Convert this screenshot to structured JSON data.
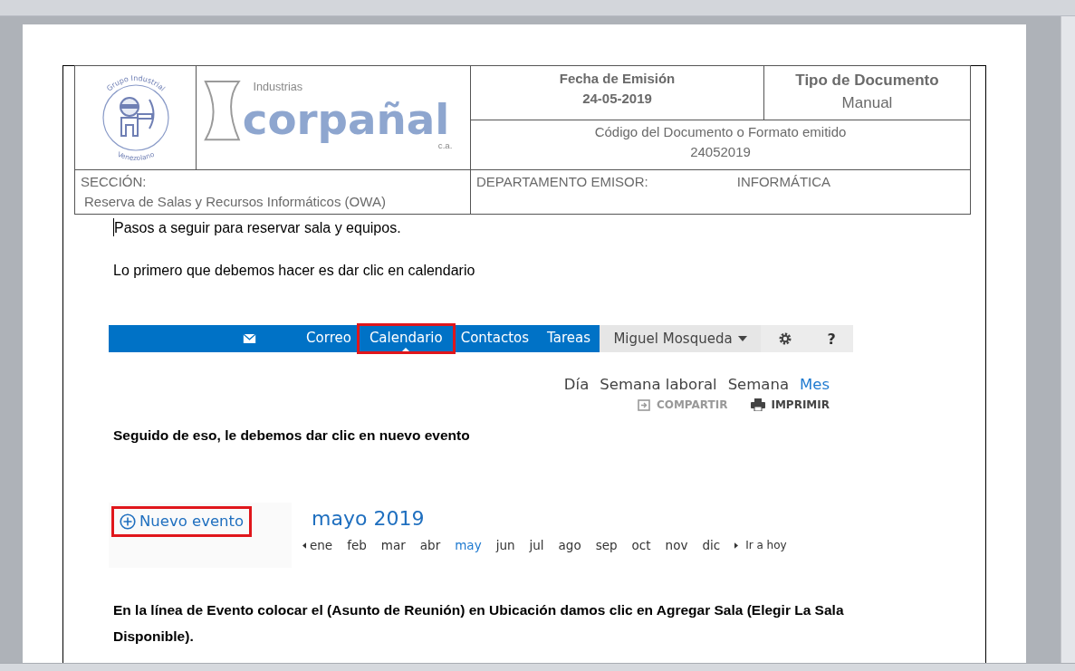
{
  "header_table": {
    "logo_left": {
      "top_text": "Grupo Industrial",
      "bottom_text": "Venezolano"
    },
    "logo_right": {
      "small_text": "Industrias",
      "name": "corpañal",
      "suffix": "c.a."
    },
    "issue_date_label": "Fecha de Emisión",
    "issue_date": "24-05-2019",
    "doc_type_label": "Tipo de Documento",
    "doc_type": "Manual",
    "code_label": "Código del Documento o Formato emitido",
    "code": "24052019",
    "section_label": "SECCIÓN:",
    "section": "Reserva de Salas y Recursos Informáticos (OWA)",
    "department_label": "DEPARTAMENTO EMISOR:",
    "department": "INFORMÁTICA"
  },
  "paragraph_1": "Pasos a seguir para reservar sala y equipos.",
  "paragraph_2": "Lo primero que debemos hacer es dar clic en calendario",
  "nav_screenshot": {
    "nav_items": [
      {
        "label": "Correo",
        "selected": false,
        "highlighted": false
      },
      {
        "label": "Calendario",
        "selected": true,
        "highlighted": true
      },
      {
        "label": "Contactos",
        "selected": false,
        "highlighted": false
      },
      {
        "label": "Tareas",
        "selected": false,
        "highlighted": false
      }
    ],
    "user": "Miguel Mosqueda",
    "help": "?",
    "views": [
      {
        "label": "Día",
        "selected": false
      },
      {
        "label": "Semana laboral",
        "selected": false
      },
      {
        "label": "Semana",
        "selected": false
      },
      {
        "label": "Mes",
        "selected": true
      }
    ],
    "actions": [
      {
        "label": "COMPARTIR",
        "kind": "share",
        "disabled": true
      },
      {
        "label": "IMPRIMIR",
        "kind": "print",
        "disabled": false
      }
    ]
  },
  "paragraph_3": "Seguido de eso, le debemos dar clic en nuevo evento",
  "calendar_screenshot": {
    "new_event": {
      "label": "Nuevo evento",
      "highlighted": true
    },
    "month_title": "mayo 2019",
    "months": [
      {
        "label": "ene",
        "selected": false
      },
      {
        "label": "feb",
        "selected": false
      },
      {
        "label": "mar",
        "selected": false
      },
      {
        "label": "abr",
        "selected": false
      },
      {
        "label": "may",
        "selected": true
      },
      {
        "label": "jun",
        "selected": false
      },
      {
        "label": "jul",
        "selected": false
      },
      {
        "label": "ago",
        "selected": false
      },
      {
        "label": "sep",
        "selected": false
      },
      {
        "label": "oct",
        "selected": false
      },
      {
        "label": "nov",
        "selected": false
      },
      {
        "label": "dic",
        "selected": false
      }
    ],
    "today": "Ir a hoy"
  },
  "paragraph_4": "En la línea de Evento colocar el (Asunto de Reunión) en Ubicación damos clic en  Agregar Sala (Elegir La Sala Disponible)."
}
